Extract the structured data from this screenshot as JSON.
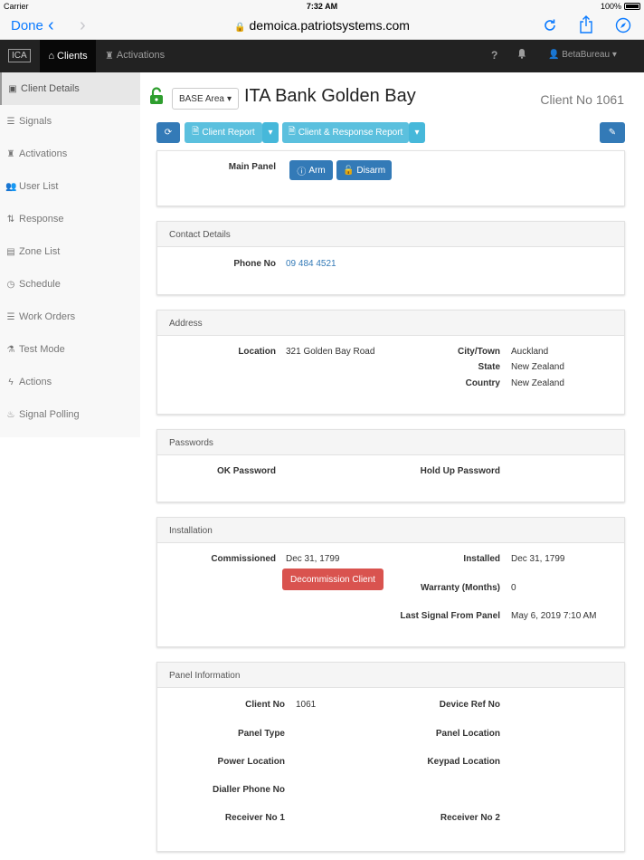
{
  "status_bar": {
    "carrier": "Carrier",
    "time": "7:32 AM",
    "battery": "100%"
  },
  "browser": {
    "done_label": "Done",
    "url": "demoica.patriotsystems.com",
    "icons": [
      "chevron-left-icon",
      "chevron-right-icon",
      "lock-icon",
      "reload-icon",
      "share-icon",
      "compass-icon"
    ]
  },
  "navbar": {
    "brand": "ICA",
    "clients_label": "Clients",
    "activations_label": "Activations",
    "help_label": "?",
    "user_label": "BetaBureau"
  },
  "sidebar": {
    "items": [
      {
        "label": "Client Details",
        "icon": "id-card-icon",
        "active": true
      },
      {
        "label": "Signals",
        "icon": "list-icon"
      },
      {
        "label": "Activations",
        "icon": "trophy-icon"
      },
      {
        "label": "User List",
        "icon": "user-icon"
      },
      {
        "label": "Response",
        "icon": "sort-icon"
      },
      {
        "label": "Zone List",
        "icon": "building-icon"
      },
      {
        "label": "Schedule",
        "icon": "clock-icon"
      },
      {
        "label": "Work Orders",
        "icon": "list-icon"
      },
      {
        "label": "Test Mode",
        "icon": "flask-icon"
      },
      {
        "label": "Actions",
        "icon": "flash-icon"
      },
      {
        "label": "Signal Polling",
        "icon": "fire-icon"
      }
    ]
  },
  "header": {
    "area_label": "BASE Area",
    "client_name": "ITA Bank Golden Bay",
    "client_no": "Client No 1061"
  },
  "toolbar": {
    "client_report": "Client Report",
    "client_response_report": "Client & Response Report"
  },
  "main_panel": {
    "label": "Main Panel",
    "arm": "Arm",
    "disarm": "Disarm"
  },
  "contact": {
    "heading": "Contact Details",
    "phone_label": "Phone No",
    "phone_value": "09 484 4521"
  },
  "address": {
    "heading": "Address",
    "location_label": "Location",
    "location_value": "321 Golden Bay Road",
    "city_label": "City/Town",
    "city_value": "Auckland",
    "state_label": "State",
    "state_value": "New Zealand",
    "country_label": "Country",
    "country_value": "New Zealand"
  },
  "passwords": {
    "heading": "Passwords",
    "ok_label": "OK Password",
    "holdup_label": "Hold Up Password"
  },
  "installation": {
    "heading": "Installation",
    "commissioned_label": "Commissioned",
    "commissioned_value": "Dec 31, 1799",
    "decommission_button": "Decommission Client",
    "installed_label": "Installed",
    "installed_value": "Dec 31, 1799",
    "warranty_label": "Warranty (Months)",
    "warranty_value": "0",
    "last_signal_label": "Last Signal From Panel",
    "last_signal_value": "May 6, 2019 7:10 AM"
  },
  "panel_info": {
    "heading": "Panel Information",
    "client_no_label": "Client No",
    "client_no_value": "1061",
    "device_ref_label": "Device Ref No",
    "panel_type_label": "Panel Type",
    "panel_location_label": "Panel Location",
    "power_location_label": "Power Location",
    "keypad_location_label": "Keypad Location",
    "dialler_label": "Dialler Phone No",
    "receiver1_label": "Receiver No 1",
    "receiver2_label": "Receiver No 2"
  },
  "colors": {
    "navbar": "#222222",
    "primary": "#337ab7",
    "info": "#5bc0de",
    "danger": "#d9534f",
    "unlock_green": "#2e9e2e",
    "ios_blue": "#0a7aff"
  }
}
